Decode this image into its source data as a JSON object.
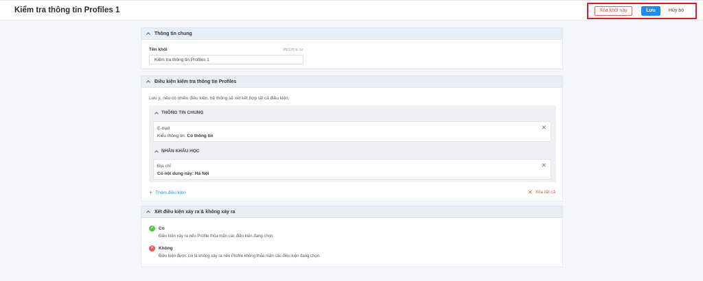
{
  "header": {
    "title": "Kiểm tra thông tin Profiles 1",
    "delete_label": "Xóa khối này",
    "save_label": "Lưu",
    "cancel_label": "Hủy bỏ",
    "highlight_color": "#e8141c"
  },
  "general": {
    "title": "Thông tin chung",
    "name_label": "Tên khối",
    "counter": "28/128 kí tự",
    "name_value": "Kiểm tra thông tin Profiles 1"
  },
  "conditions": {
    "title": "Điều kiện kiểm tra thông tin Profiles",
    "note": "Lưu ý, nếu có nhiều điều kiện, hệ thống sẽ xét kết hợp tất cả điều kiện.",
    "groups": [
      {
        "label": "THÔNG TIN CHUNG",
        "item": {
          "name": "E-mail",
          "desc_prefix": "Kiểu thông tin: ",
          "desc_value": "Có thông tin"
        }
      },
      {
        "label": "NHÂN KHẨU HỌC",
        "item": {
          "name": "Địa chỉ",
          "desc_prefix": "Có nội dung này: ",
          "desc_value": "Hà Nội"
        }
      }
    ],
    "add_label": "Thêm điều kiện",
    "clear_label": "Xóa tất cả"
  },
  "occurrence": {
    "title": "Xét điều kiện xảy ra & không xảy ra",
    "yes_label": "Có",
    "yes_desc": "Điều kiện xảy ra nếu Profile thỏa mãn các điều kiện đang chọn.",
    "no_label": "Không",
    "no_desc": "Điều kiện được coi là không xảy ra nếu Profile không thỏa mãn các điều kiện đang chọn."
  },
  "icons": {
    "close": "close-icon",
    "plus": "plus-icon",
    "check": "check-icon",
    "cross": "cross-icon",
    "chevron": "chevron-up-icon"
  },
  "colors": {
    "primary": "#1f8ded",
    "danger": "#e53e3e",
    "success": "#5fc146"
  }
}
